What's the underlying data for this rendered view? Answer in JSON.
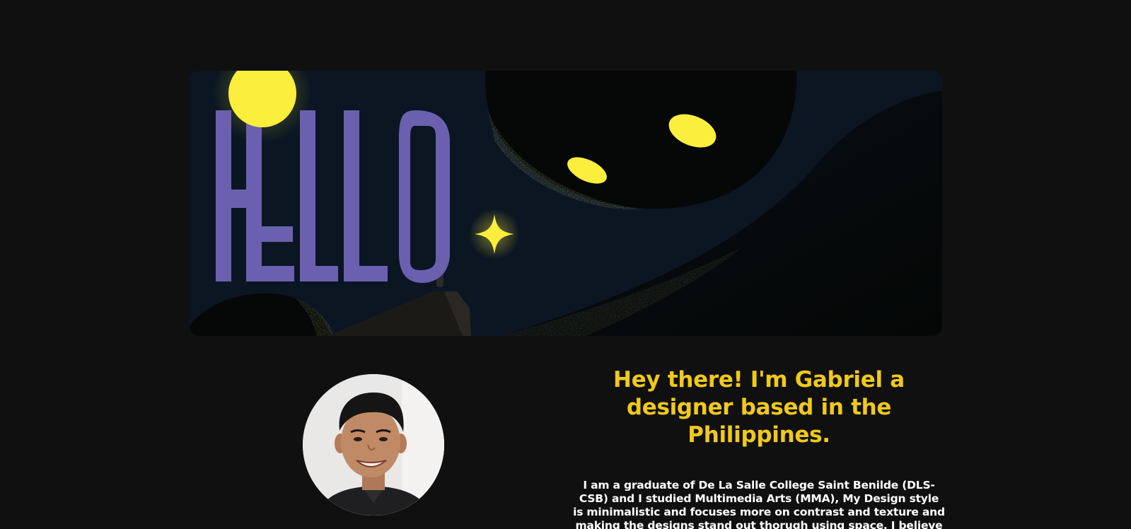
{
  "hero": {
    "banner_text": "HELLO",
    "colors": {
      "sky": "#0b1622",
      "dark_shape": "#050806",
      "letters": "#6b60b0",
      "glow_yellow": "#fbee3c",
      "headline": "#f0c91a"
    }
  },
  "about": {
    "headline": "Hey there! I'm Gabriel a designer based in the Philippines.",
    "bio": "I am a graduate of De La Salle College Saint Benilde (DLS-CSB) and I studied Multimedia Arts (MMA), My Design style is minimalistic and focuses more on contrast and texture and making the designs stand out thorugh using space. I believe"
  }
}
